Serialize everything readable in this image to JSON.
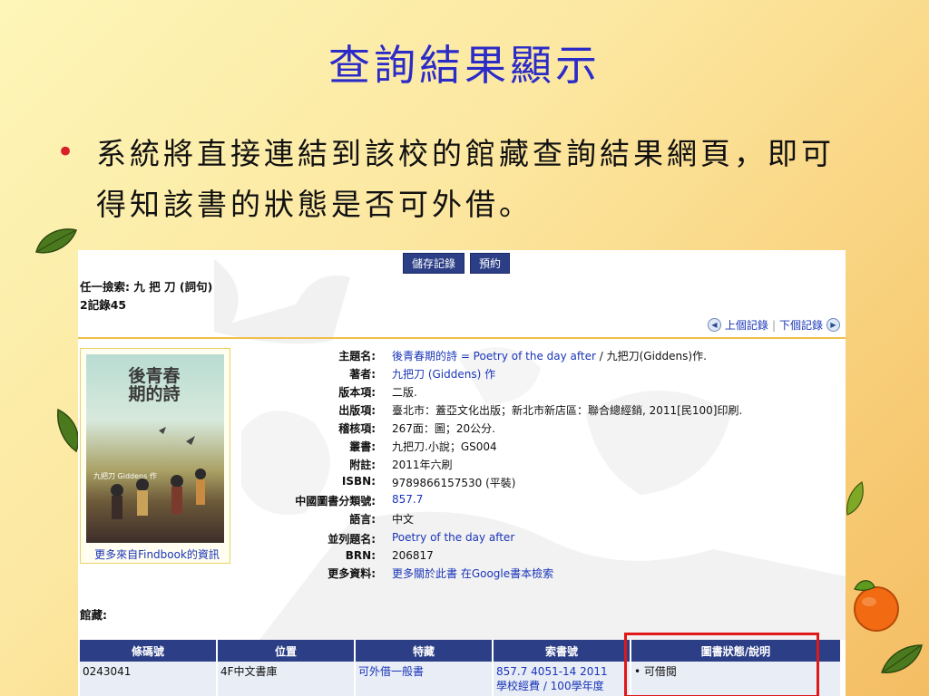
{
  "slide": {
    "title": "查詢結果顯示",
    "bullet": "系統將直接連結到該校的館藏查詢結果網頁，即可得知該書的狀態是否可外借。"
  },
  "toolbar": {
    "save_label": "儲存記錄",
    "reserve_label": "預約"
  },
  "search": {
    "query": "任一撿索: 九 把 刀 (詞句)",
    "record_count": "2記錄45"
  },
  "record_nav": {
    "prev_label": "上個記錄",
    "next_label": "下個記錄"
  },
  "cover": {
    "title_text": "後青春期的詩",
    "author_small": "九把刀 Giddens 作",
    "findbook_link": "更多來自Findbook的資訊"
  },
  "fields": [
    {
      "label": "主題名:",
      "value": "後青春期的詩 = Poetry of the day after",
      "suffix": " / 九把刀(Giddens)作."
    },
    {
      "label": "著者:",
      "value": "九把刀 (Giddens) 作",
      "suffix": ""
    },
    {
      "label": "版本項:",
      "value": "二版.",
      "suffix": ""
    },
    {
      "label": "出版項:",
      "value": "臺北市：蓋亞文化出版；新北市新店區：聯合總經銷, 2011[民100]印刷.",
      "suffix": ""
    },
    {
      "label": "稽核項:",
      "value": "267面：圖；20公分.",
      "suffix": ""
    },
    {
      "label": "叢書:",
      "value": "九把刀.小說；GS004",
      "suffix": ""
    },
    {
      "label": "附註:",
      "value": "2011年六刷",
      "suffix": ""
    },
    {
      "label": "ISBN:",
      "value": "9789866157530 (平裝)",
      "suffix": ""
    },
    {
      "label": "中國圖書分類號:",
      "value": "857.7",
      "suffix": ""
    },
    {
      "label": "語言:",
      "value": "中文",
      "suffix": ""
    },
    {
      "label": "並列題名:",
      "value": "Poetry of the day after",
      "suffix": ""
    },
    {
      "label": "BRN:",
      "value": "206817",
      "suffix": ""
    },
    {
      "label": "更多資料:",
      "value": "更多關於此書 在Google書本檢索",
      "suffix": ""
    }
  ],
  "holdings": {
    "label": "館藏:",
    "headers": [
      "條碼號",
      "位置",
      "特藏",
      "索書號",
      "圖書狀態/說明"
    ],
    "rows": [
      {
        "barcode": "0243041",
        "location": "4F中文書庫",
        "collection": "可外借一般書",
        "callno": "857.7 4051-14 2011",
        "callno_note": "學校經費 / 100學年度",
        "status": "可借閱"
      }
    ]
  },
  "colors": {
    "title_blue": "#2b2bc8",
    "bullet_red": "#d9202a",
    "header_navy": "#2b3e86",
    "link_blue": "#1a35b8",
    "highlight_red": "#e01818"
  }
}
